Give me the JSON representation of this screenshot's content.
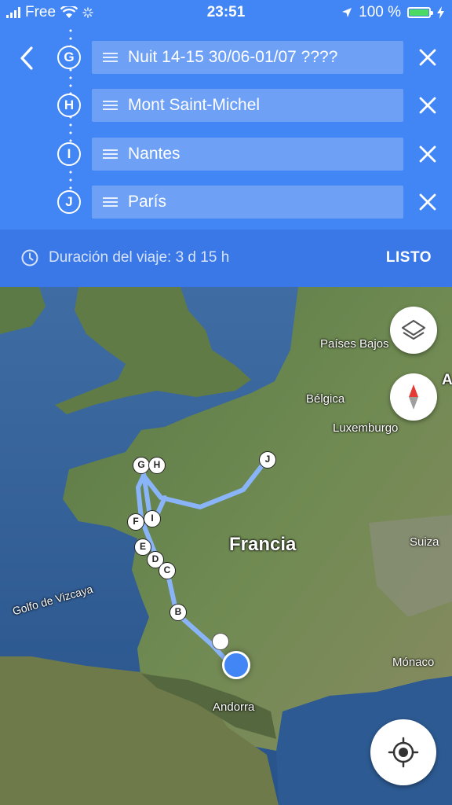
{
  "status_bar": {
    "carrier": "Free",
    "time": "23:51",
    "battery": "100 %",
    "battery_level": 1.0
  },
  "header": {
    "back_icon": "chevron-left-icon",
    "stops": [
      {
        "letter": "G",
        "name": "Nuit 14-15 30/06-01/07 ????"
      },
      {
        "letter": "H",
        "name": "Mont Saint-Michel"
      },
      {
        "letter": "I",
        "name": "Nantes"
      },
      {
        "letter": "J",
        "name": "París"
      }
    ]
  },
  "trip": {
    "duration": "Duración del viaje: 3 d 15 h",
    "done_label": "LISTO"
  },
  "map": {
    "labels": {
      "netherlands": "Países Bajos",
      "belgium": "Bélgica",
      "luxembourg": "Luxemburgo",
      "france": "Francia",
      "switzerland": "Suiza",
      "monaco": "Mónaco",
      "andorra": "Andorra",
      "bay": "Golfo de Vizcaya",
      "edge": "A"
    },
    "route_markers": [
      "G",
      "H",
      "F",
      "I",
      "E",
      "D",
      "C",
      "B",
      "J"
    ],
    "route_color": "#8ab4f8"
  },
  "colors": {
    "header_blue": "#4285f4",
    "header_dark": "#3b78e7",
    "current_location": "#4285f4"
  }
}
